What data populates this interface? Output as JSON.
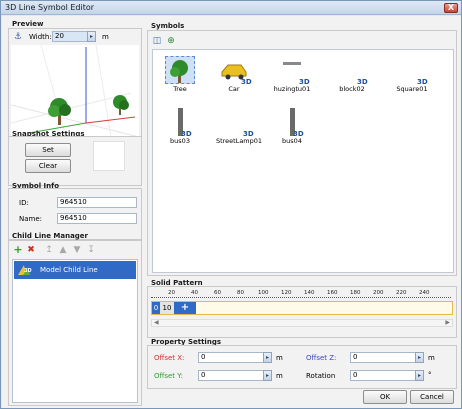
{
  "window": {
    "title": "3D Line Symbol Editor",
    "close": "X"
  },
  "preview": {
    "title": "Preview",
    "width_label": "Width:",
    "width_value": "20",
    "unit": "m"
  },
  "snapshot": {
    "title": "Snapshot Settings",
    "set": "Set",
    "clear": "Clear"
  },
  "symbol_info": {
    "title": "Symbol Info",
    "id_label": "ID:",
    "id_value": "964510",
    "name_label": "Name:",
    "name_value": "964510"
  },
  "child_manager": {
    "title": "Child Line Manager",
    "items": [
      {
        "label": "Model Child Line",
        "badge": "3D"
      }
    ]
  },
  "symbols": {
    "title": "Symbols",
    "items": [
      {
        "label": "Tree",
        "badge": "",
        "selected": true
      },
      {
        "label": "Car",
        "badge": "3D"
      },
      {
        "label": "huzingtu01",
        "badge": "3D"
      },
      {
        "label": "block02",
        "badge": "3D"
      },
      {
        "label": "Square01",
        "badge": "3D"
      },
      {
        "label": "bus03",
        "badge": "3D"
      },
      {
        "label": "StreetLamp01",
        "badge": "3D"
      },
      {
        "label": "bus04",
        "badge": "3D"
      }
    ]
  },
  "pattern": {
    "title": "Solid Pattern",
    "ruler": [
      "20",
      "40",
      "60",
      "80",
      "100",
      "120",
      "140",
      "160",
      "180",
      "200",
      "220",
      "240"
    ],
    "cells": [
      "0",
      "10"
    ],
    "add": "+"
  },
  "property": {
    "title": "Property Settings",
    "offset_x_label": "Offset X:",
    "offset_x_value": "0",
    "offset_z_label": "Offset Z:",
    "offset_z_value": "0",
    "offset_y_label": "Offset Y:",
    "offset_y_value": "0",
    "rotation_label": "Rotation",
    "rotation_value": "0",
    "unit_m": "m",
    "unit_deg": "°"
  },
  "footer": {
    "ok": "OK",
    "cancel": "Cancel"
  },
  "colors": {
    "offset_x": "#d0302a",
    "offset_y": "#2da02d",
    "offset_z": "#3a46c8",
    "selection": "#3169c6"
  }
}
